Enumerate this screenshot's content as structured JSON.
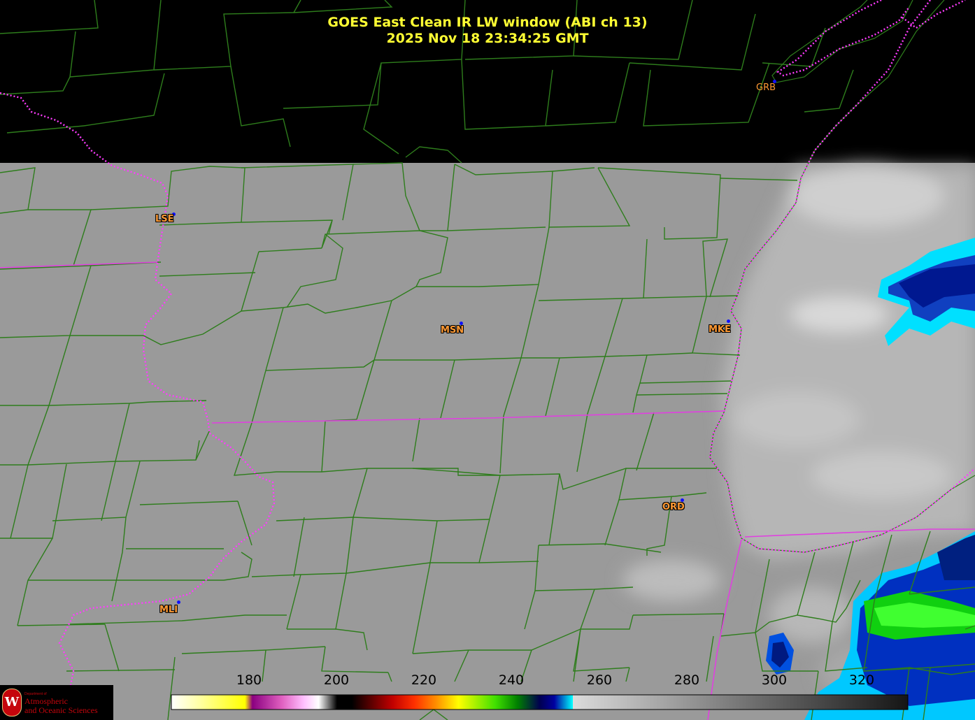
{
  "title": {
    "line1": "GOES East Clean IR LW window (ABI ch 13)",
    "line2": "2025 Nov 18  23:34:25 GMT"
  },
  "cities": [
    {
      "code": "GRB",
      "style": "plain"
    },
    {
      "code": "LSE",
      "style": "outlined"
    },
    {
      "code": "MSN",
      "style": "outlined"
    },
    {
      "code": "MKE",
      "style": "outlined"
    },
    {
      "code": "ORD",
      "style": "outlined"
    },
    {
      "code": "MLI",
      "style": "outlined"
    }
  ],
  "colorbar": {
    "unit_range": [
      163,
      335
    ],
    "ticks": [
      "180",
      "200",
      "220",
      "240",
      "260",
      "280",
      "300",
      "320"
    ]
  },
  "colors": {
    "title": "#ffff33",
    "county_lines": "#2e7d1c",
    "state_lines": "#e040e0",
    "city_label": "#ff9933",
    "city_dot": "#1010ff",
    "background_gray": "#9a9a9a"
  },
  "logo": {
    "seal_letter": "W",
    "dept_small": "Department of",
    "line1": "Atmospheric",
    "line2": "and Oceanic Sciences"
  }
}
